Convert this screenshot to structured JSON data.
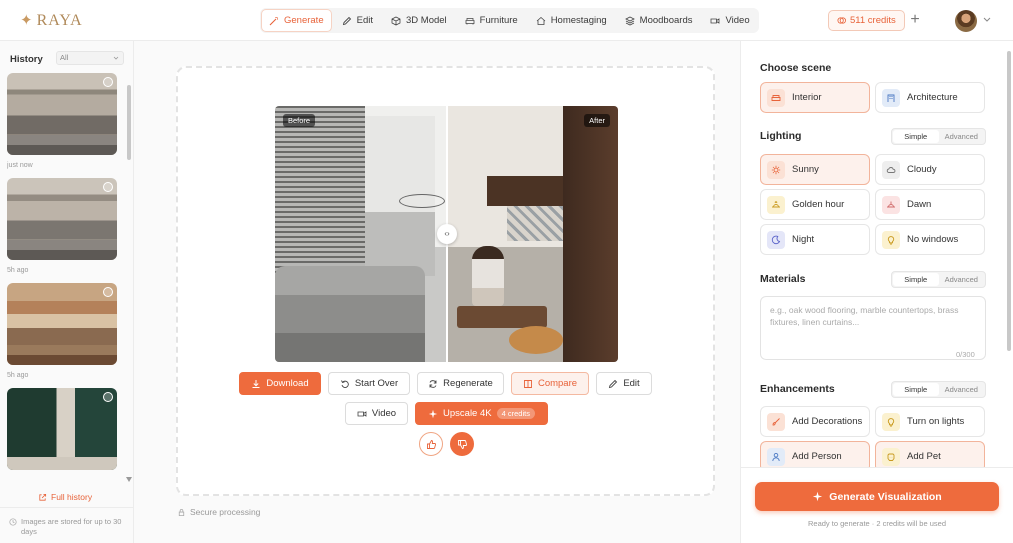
{
  "brand": {
    "name": "RAYA"
  },
  "nav": {
    "items": [
      {
        "label": "Generate",
        "icon": "wand-icon",
        "active": true
      },
      {
        "label": "Edit",
        "icon": "pencil-icon"
      },
      {
        "label": "3D Model",
        "icon": "cube-icon"
      },
      {
        "label": "Furniture",
        "icon": "sofa-icon"
      },
      {
        "label": "Homestaging",
        "icon": "home-icon"
      },
      {
        "label": "Moodboards",
        "icon": "layers-icon"
      },
      {
        "label": "Video",
        "icon": "video-icon"
      }
    ],
    "credits_label": "511 credits"
  },
  "history": {
    "title": "History",
    "filter": "All",
    "items": [
      {
        "time": "just now"
      },
      {
        "time": "5h ago"
      },
      {
        "time": "5h ago"
      },
      {
        "time": ""
      }
    ],
    "full_history_label": "Full history",
    "storage_note": "Images are stored for up to 30 days"
  },
  "compare": {
    "before_label": "Before",
    "after_label": "After"
  },
  "actions": {
    "download": "Download",
    "start_over": "Start Over",
    "regenerate": "Regenerate",
    "compare": "Compare",
    "edit": "Edit",
    "video": "Video",
    "upscale": "Upscale 4K",
    "upscale_cost": "4 credits"
  },
  "secure_label": "Secure processing",
  "panel": {
    "scene": {
      "title": "Choose scene",
      "options": [
        {
          "label": "Interior",
          "selected": true
        },
        {
          "label": "Architecture",
          "selected": false
        }
      ]
    },
    "lighting": {
      "title": "Lighting",
      "modes": [
        "Simple",
        "Advanced"
      ],
      "options": [
        {
          "label": "Sunny",
          "selected": true
        },
        {
          "label": "Cloudy"
        },
        {
          "label": "Golden hour"
        },
        {
          "label": "Dawn"
        },
        {
          "label": "Night"
        },
        {
          "label": "No windows"
        }
      ]
    },
    "materials": {
      "title": "Materials",
      "modes": [
        "Simple",
        "Advanced"
      ],
      "placeholder": "e.g., oak wood flooring, marble countertops, brass fixtures, linen curtains...",
      "counter": "0/300"
    },
    "enhancements": {
      "title": "Enhancements",
      "modes": [
        "Simple",
        "Advanced"
      ],
      "options": [
        {
          "label": "Add Decorations"
        },
        {
          "label": "Turn on lights"
        },
        {
          "label": "Add Person",
          "selected": true
        },
        {
          "label": "Add Pet",
          "selected": true
        }
      ]
    },
    "generate_label": "Generate Visualization",
    "ready_note": "Ready to generate · 2 credits will be used"
  },
  "colors": {
    "accent": "#ee6b3d",
    "accent_soft": "#fdf1ec",
    "brand": "#b08a5a"
  }
}
